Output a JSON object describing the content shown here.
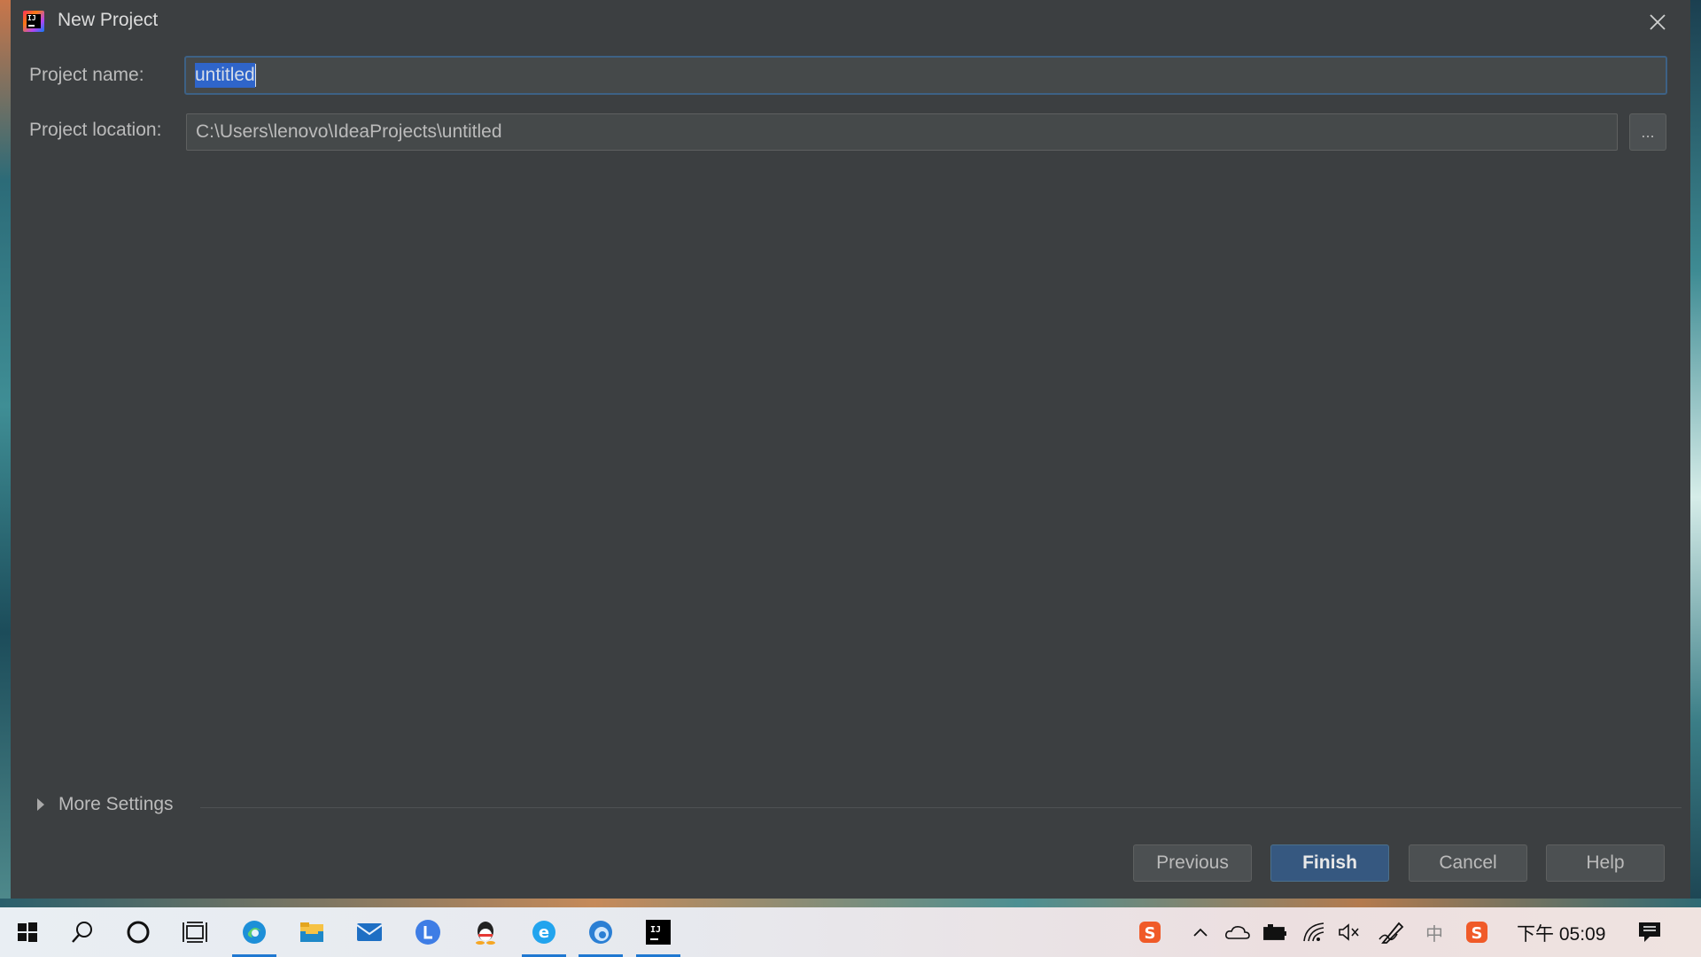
{
  "dialog": {
    "title": "New Project",
    "app_icon_text": "IJ"
  },
  "form": {
    "name_label": "Project name:",
    "name_value": "untitled",
    "location_label": "Project location:",
    "location_value": "C:\\Users\\lenovo\\IdeaProjects\\untitled",
    "browse_label": "..."
  },
  "more_settings": {
    "label": "More Settings"
  },
  "buttons": {
    "previous": "Previous",
    "finish": "Finish",
    "cancel": "Cancel",
    "help": "Help"
  },
  "taskbar": {
    "pinned": [
      "start-icon",
      "search-icon",
      "cortana-icon",
      "task-view-icon",
      "edge-icon",
      "file-explorer-icon",
      "mail-icon",
      "app-l-icon",
      "qq-icon",
      "browser-e-icon",
      "edge-beta-icon",
      "intellij-icon"
    ],
    "tray": [
      "sogou-icon",
      "chevron-up-icon",
      "onedrive-icon",
      "battery-icon",
      "wifi-icon",
      "volume-muted-icon",
      "pen-icon",
      "ime-icon",
      "sogou-tray-icon"
    ],
    "ime_label": "中",
    "clock": "下午 05:09"
  },
  "colors": {
    "dialog_bg": "#3c3f41",
    "accent": "#365880",
    "selection": "#2f65ca"
  }
}
